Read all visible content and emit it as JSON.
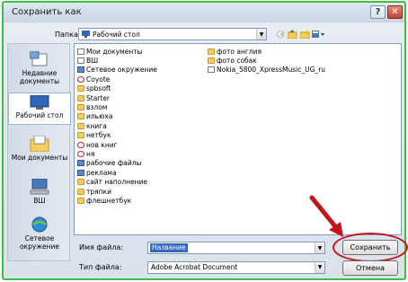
{
  "window": {
    "title": "Сохранить как"
  },
  "toolbar": {
    "folder_label": "Папка:",
    "folder_value": "Рабочий стол"
  },
  "places": [
    {
      "label": "Недавние документы",
      "icon": "recent-documents-icon"
    },
    {
      "label": "Рабочий стол",
      "icon": "desktop-icon"
    },
    {
      "label": "Мои документы",
      "icon": "my-documents-icon"
    },
    {
      "label": "ВШ",
      "icon": "computer-icon"
    },
    {
      "label": "Сетевое окружение",
      "icon": "network-icon"
    }
  ],
  "files_col1": [
    {
      "name": "Мои документы",
      "icon": "file"
    },
    {
      "name": "ВШ",
      "icon": "file"
    },
    {
      "name": "Сетевое окружение",
      "icon": "blue"
    },
    {
      "name": "Coyote",
      "icon": "red"
    },
    {
      "name": "spbsoft",
      "icon": "folder"
    },
    {
      "name": "Starter",
      "icon": "folder"
    },
    {
      "name": "взлом",
      "icon": "folder"
    },
    {
      "name": "ильюха",
      "icon": "folder"
    },
    {
      "name": "книга",
      "icon": "folder"
    },
    {
      "name": "нетбук",
      "icon": "folder"
    },
    {
      "name": "нов книг",
      "icon": "red"
    },
    {
      "name": "ня",
      "icon": "red"
    },
    {
      "name": "рабочие файлы",
      "icon": "blue"
    },
    {
      "name": "реклама",
      "icon": "blue"
    },
    {
      "name": "сайт наполнение",
      "icon": "folder"
    },
    {
      "name": "тряпки",
      "icon": "folder"
    },
    {
      "name": "флешнетбук",
      "icon": "folder"
    }
  ],
  "files_col2": [
    {
      "name": "фото англия",
      "icon": "folder"
    },
    {
      "name": "фото собак",
      "icon": "folder"
    },
    {
      "name": "Nokia_5800_XpressMusic_UG_ru",
      "icon": "file"
    }
  ],
  "form": {
    "filename_label": "Имя файла:",
    "filename_value": "Название",
    "filetype_label": "Тип файла:",
    "filetype_value": "Adobe Acrobat Document"
  },
  "buttons": {
    "save": "Сохранить",
    "cancel": "Отмена"
  },
  "colors": {
    "highlight": "#c0161b",
    "selection": "#3169c6",
    "frame": "#3fbf3f"
  }
}
